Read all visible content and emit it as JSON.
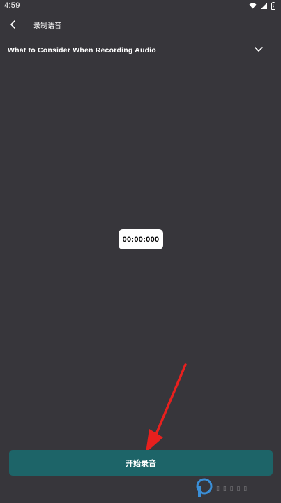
{
  "status_bar": {
    "time": "4:59",
    "icons": [
      "wifi-icon",
      "signal-icon",
      "battery-icon"
    ]
  },
  "app_bar": {
    "back_icon": "chevron-left-icon",
    "title": "录制语音"
  },
  "consider_section": {
    "label": "What to Consider When Recording Audio",
    "expand_icon": "chevron-down-icon"
  },
  "timer": {
    "value": "00:00:000"
  },
  "record_button": {
    "label": "开始录音"
  },
  "colors": {
    "background": "#37363b",
    "button": "#1d6468",
    "annotation_arrow": "#e8201e"
  }
}
